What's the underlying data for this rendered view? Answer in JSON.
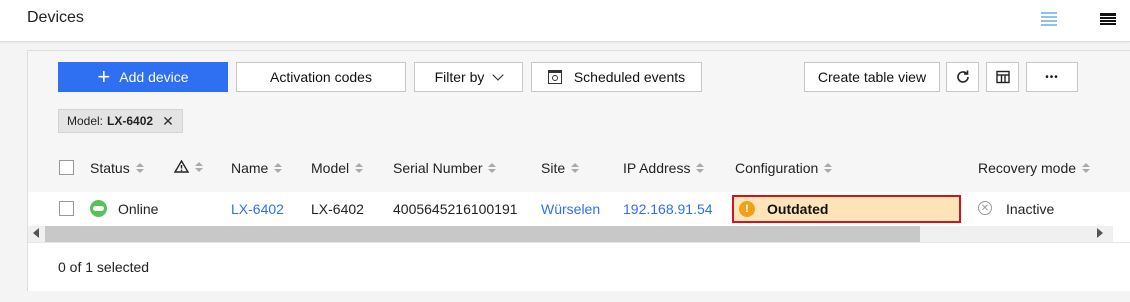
{
  "header": {
    "title": "Devices"
  },
  "toolbar": {
    "add_device": "Add device",
    "activation_codes": "Activation codes",
    "filter_by": "Filter by",
    "scheduled_events": "Scheduled events",
    "create_table_view": "Create table view",
    "more": "•••"
  },
  "filter_chip": {
    "label": "Model:",
    "value": "LX-6402"
  },
  "columns": [
    "Status",
    "Name",
    "Model",
    "Serial Number",
    "Site",
    "IP Address",
    "Configuration",
    "Recovery mode"
  ],
  "rows": [
    {
      "status": "Online",
      "name": "LX-6402",
      "model": "LX-6402",
      "serial": "4005645216100191",
      "site": "Würselen",
      "ip": "192.168.91.54",
      "configuration": "Outdated",
      "recovery": "Inactive"
    }
  ],
  "footer": {
    "selected": "0 of 1 selected"
  },
  "colors": {
    "accent": "#2f6ff2",
    "online": "#58c25a",
    "warning_bg": "#fde4b9",
    "highlight_border": "#d4141a"
  }
}
